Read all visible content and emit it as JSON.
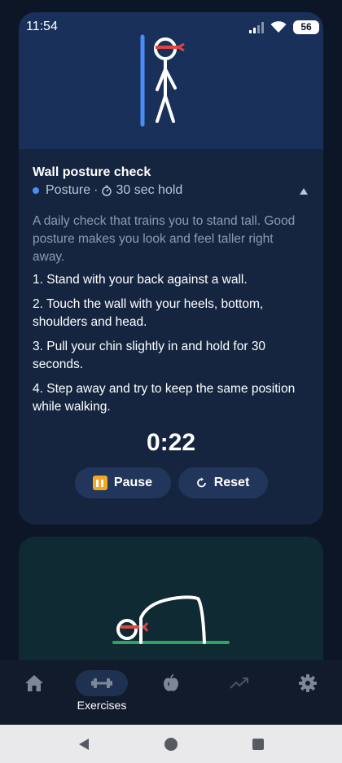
{
  "status_bar": {
    "time": "11:54",
    "battery": "56"
  },
  "exercise": {
    "title": "Wall posture check",
    "category": "Posture",
    "duration": "30 sec hold",
    "intro": "A daily check that trains you to stand tall. Good posture makes you look and feel taller right away.",
    "steps": [
      "1. Stand with your back against a wall.",
      "2. Touch the wall with your heels, bottom, shoulders and head.",
      "3. Pull your chin slightly in and hold for 30 seconds.",
      "4. Step away and try to keep the same position while walking."
    ],
    "timer": "0:22",
    "pause_label": "Pause",
    "reset_label": "Reset"
  },
  "bottom_nav": {
    "items": [
      {
        "icon": "home-icon",
        "label": ""
      },
      {
        "icon": "dumbbell-icon",
        "label": "Exercises",
        "active": true
      },
      {
        "icon": "apple-icon",
        "label": ""
      },
      {
        "icon": "trend-icon",
        "label": ""
      },
      {
        "icon": "gear-icon",
        "label": ""
      }
    ]
  },
  "colors": {
    "background": "#0c1626",
    "card": "#152540",
    "accent_blue": "#4a8ef5",
    "accent_red": "#e0453e",
    "accent_green": "#2fa360",
    "pause_orange": "#f5a623"
  }
}
